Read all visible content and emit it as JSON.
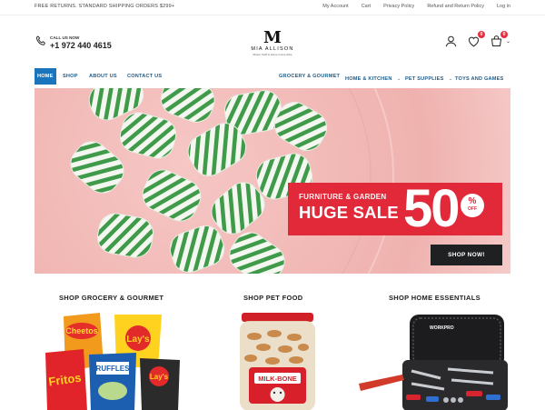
{
  "topbar": {
    "promo": "FREE RETURNS. STANDARD SHIPPING ORDERS $299+",
    "links": [
      "My Account",
      "Cart",
      "Privacy Policy",
      "Refund and Return Policy",
      "Log in"
    ]
  },
  "header": {
    "call_label": "CALL US NOW",
    "phone": "+1 972 440 4615",
    "logo_mark": "M",
    "logo_name": "MIA ALLISON",
    "logo_tag": "Where Stuff & Home Come Alive",
    "wishlist_count": "0",
    "cart_count": "0"
  },
  "nav": {
    "items": [
      {
        "label": "HOME"
      },
      {
        "label": "SHOP"
      },
      {
        "label": "ABOUT US"
      },
      {
        "label": "CONTACT US"
      },
      {
        "label": "GROCERY & GOURMET"
      },
      {
        "label": "HOME & KITCHEN"
      },
      {
        "label": "PET SUPPLIES"
      },
      {
        "label": "TOYS AND GAMES"
      }
    ],
    "caret": "⌄"
  },
  "hero": {
    "subtitle": "FURNITURE & GARDEN",
    "headline": "HUGE SALE",
    "discount": "50",
    "percent": "%",
    "off": "OFF",
    "button": "SHOP NOW!"
  },
  "categories": [
    {
      "title": "SHOP GROCERY & GOURMET"
    },
    {
      "title": "SHOP PET FOOD"
    },
    {
      "title": "SHOP HOME ESSENTIALS"
    }
  ],
  "products": {
    "chips": [
      "Cheetos",
      "Lay's",
      "Fritos",
      "RUFFLES",
      "Lay's"
    ],
    "treats": "MILK-BONE",
    "toolkit": "WORKPRO"
  },
  "colors": {
    "accent": "#1b75bc",
    "nav_text": "#1f5c8a",
    "sale_red": "#e2293a",
    "badge_red": "#e7303f",
    "button_dark": "#1f2022",
    "hero_pink": "#f1b9b6"
  }
}
